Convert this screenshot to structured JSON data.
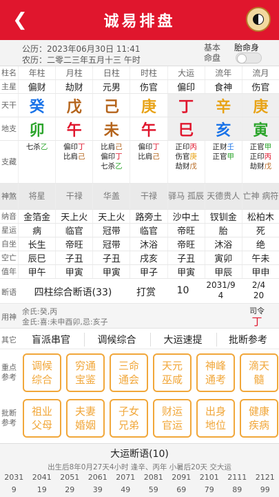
{
  "header": {
    "title": "诚易排盘"
  },
  "info": {
    "gongli": "公历：2023年06月30日 11:41",
    "nongli": "农历：二零二三年五月十三 午时",
    "basic_label": "基本命盘",
    "taiming_label": "胎命身"
  },
  "labels": {
    "zhuming": "柱名",
    "zhuxing": "主星",
    "tiangan": "天干",
    "dizhi": "地支",
    "canggan": "支藏",
    "shensha": "神煞",
    "nayin": "纳音",
    "xingyun": "星运",
    "zizuo": "自坐",
    "kongwang": "空亡",
    "zhiyin": "值年",
    "duanyu": "断语",
    "yongshen": "用神",
    "qita": "其它",
    "zhongdian": "重点参考",
    "pidian": "批断参考"
  },
  "columns": [
    {
      "name": "年柱",
      "star": "偏财",
      "gan": "癸",
      "zhi": "卯",
      "gc": "#1a73e8",
      "zc": "#2ca52c",
      "cang": [
        {
          "t": "七杀",
          "g": "乙",
          "c": "#2ca52c"
        }
      ],
      "shensha": "将星",
      "nayin": "金箔金",
      "xingyun": "病",
      "zizuo": "长生",
      "kong": "辰巳",
      "zhiyin": "甲午"
    },
    {
      "name": "月柱",
      "star": "劫财",
      "gan": "戊",
      "zhi": "午",
      "gc": "#b5651d",
      "zc": "#e0162d",
      "cang": [
        {
          "t": "偏印",
          "g": "丁",
          "c": "#e0162d"
        },
        {
          "t": "比肩",
          "g": "己",
          "c": "#b5651d"
        }
      ],
      "shensha": "干禄",
      "nayin": "天上火",
      "xingyun": "临官",
      "zizuo": "帝旺",
      "kong": "子丑",
      "zhiyin": "甲寅"
    },
    {
      "name": "日柱",
      "star": "元男",
      "gan": "己",
      "zhi": "未",
      "gc": "#b5651d",
      "zc": "#b5651d",
      "cang": [
        {
          "t": "比肩",
          "g": "己",
          "c": "#b5651d"
        },
        {
          "t": "偏印",
          "g": "丁",
          "c": "#e0162d"
        },
        {
          "t": "七杀",
          "g": "乙",
          "c": "#2ca52c"
        }
      ],
      "shensha": "华盖",
      "nayin": "天上火",
      "xingyun": "冠带",
      "zizuo": "冠带",
      "kong": "子丑",
      "zhiyin": "甲寅"
    },
    {
      "name": "时柱",
      "star": "伤官",
      "gan": "庚",
      "zhi": "午",
      "gc": "#e8a317",
      "zc": "#e0162d",
      "cang": [
        {
          "t": "偏印",
          "g": "丁",
          "c": "#e0162d"
        },
        {
          "t": "比肩",
          "g": "己",
          "c": "#b5651d"
        }
      ],
      "shensha": "干禄",
      "nayin": "路旁土",
      "xingyun": "临官",
      "zizuo": "沐浴",
      "kong": "戌亥",
      "zhiyin": "甲子"
    },
    {
      "name": "大运",
      "star": "偏印",
      "gan": "丁",
      "zhi": "巳",
      "gc": "#e0162d",
      "zc": "#e0162d",
      "cang": [
        {
          "t": "正印",
          "g": "丙",
          "c": "#e0162d"
        },
        {
          "t": "伤官",
          "g": "庚",
          "c": "#e8a317"
        },
        {
          "t": "劫财",
          "g": "戊",
          "c": "#b5651d"
        }
      ],
      "shensha": "驿马 孤辰",
      "nayin": "沙中土",
      "xingyun": "帝旺",
      "zizuo": "帝旺",
      "kong": "子丑",
      "zhiyin": "甲寅"
    },
    {
      "name": "流年",
      "star": "食神",
      "gan": "辛",
      "zhi": "亥",
      "gc": "#e8a317",
      "zc": "#1a73e8",
      "cang": [
        {
          "t": "正财",
          "g": "壬",
          "c": "#1a73e8"
        },
        {
          "t": "正官",
          "g": "甲",
          "c": "#2ca52c"
        }
      ],
      "shensha": "天德贵人",
      "nayin": "钗钏金",
      "xingyun": "胎",
      "zizuo": "沐浴",
      "kong": "寅卯",
      "zhiyin": "甲辰"
    },
    {
      "name": "流月",
      "star": "伤官",
      "gan": "庚",
      "zhi": "寅",
      "gc": "#e8a317",
      "zc": "#2ca52c",
      "cang": [
        {
          "t": "正官",
          "g": "甲",
          "c": "#2ca52c"
        },
        {
          "t": "正印",
          "g": "丙",
          "c": "#e0162d"
        },
        {
          "t": "劫财",
          "g": "戊",
          "c": "#b5651d"
        }
      ],
      "shensha": "亡神 病符",
      "nayin": "松柏木",
      "xingyun": "死",
      "zizuo": "绝",
      "kong": "午未",
      "zhiyin": "甲申"
    }
  ],
  "duanyu": {
    "sizhu": "四柱综合断语(33)",
    "dashang": "打赏",
    "num": "10",
    "date": "2031/9",
    "date2": "4",
    "md": "2/4",
    "md2": "20"
  },
  "yongshen": {
    "line1": "余氏:癸,丙",
    "line2": "金氏:喜:未申酉卯,忌:亥子",
    "siling_label": "司令",
    "siling": "丁"
  },
  "qita": [
    "盲派串官",
    "调候综合",
    "大运速提",
    "批断参考"
  ],
  "zhongdian": [
    "调候综合",
    "穷通宝鉴",
    "三命通会",
    "天元巫咸",
    "神峰通考",
    "滴天髓"
  ],
  "pidian": [
    "祖业父母",
    "夫妻婚姻",
    "子女兄弟",
    "财运官运",
    "出身地位",
    "健康疾病"
  ],
  "dayun": {
    "title": "大运断语(10)",
    "desc": "出生后8年0月27天4小时 逢辛、丙年 小暑后20天 交大运",
    "years": [
      "2031",
      "2041",
      "2051",
      "2061",
      "2071",
      "2081",
      "2091",
      "2101",
      "2111",
      "2121"
    ],
    "ages": [
      "9",
      "19",
      "29",
      "39",
      "49",
      "59",
      "69",
      "79",
      "89",
      "99"
    ]
  }
}
